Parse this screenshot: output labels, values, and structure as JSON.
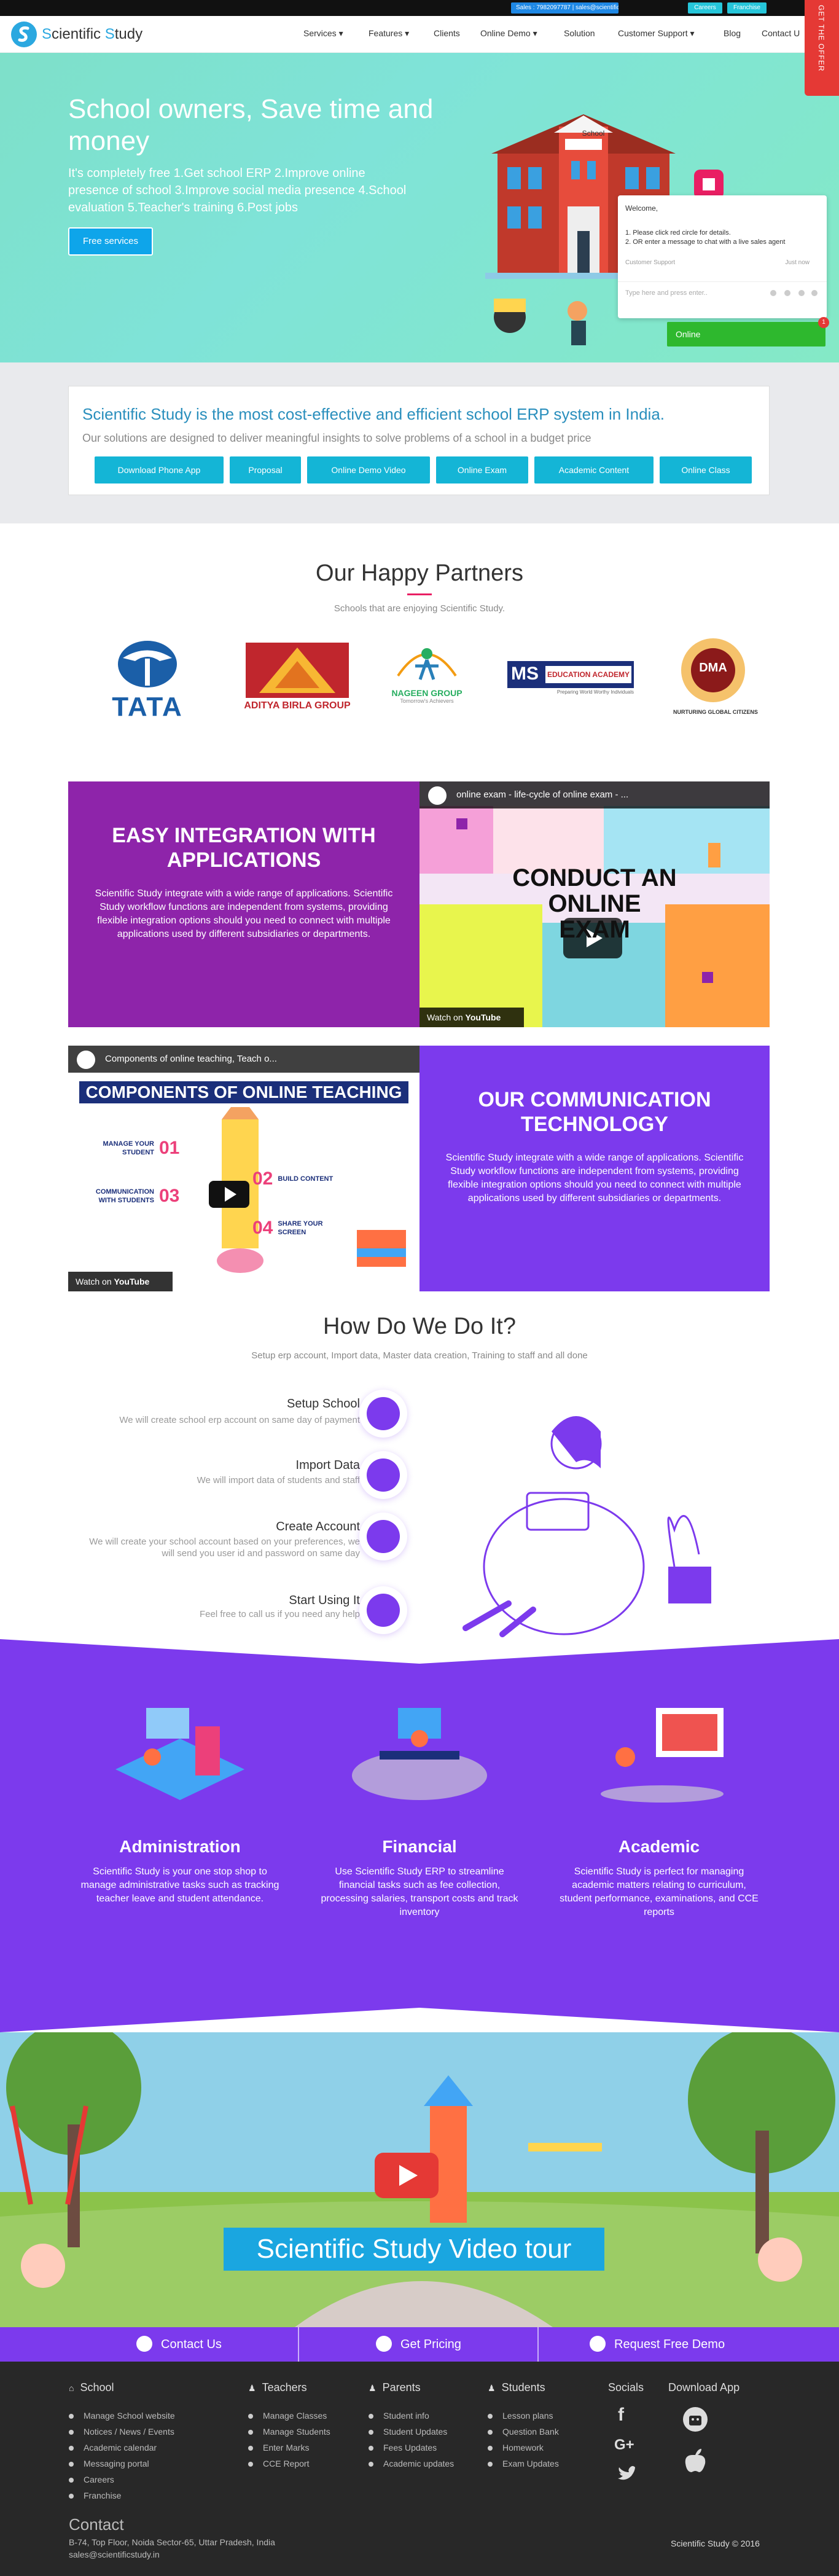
{
  "topbar": {
    "sales": "Sales : 7982097787 | sales@scientificstudy.in",
    "careers": "Careers",
    "franchise": "Franchise"
  },
  "offer_ribbon": "GET THE OFFER",
  "header": {
    "logo_s": "S",
    "logo_first": "cientific ",
    "logo_s2": "S",
    "logo_rest": "tudy",
    "nav": [
      "Services ▾",
      "Features ▾",
      "Clients",
      "Online Demo ▾",
      "Solution",
      "Customer Support ▾",
      "Blog",
      "Contact U"
    ]
  },
  "hero": {
    "title": "School owners, Save time and money",
    "subtitle": "It's completely free 1.Get school ERP 2.Improve online presence of school 3.Improve social media presence 4.School evaluation 5.Teacher's training 6.Post jobs",
    "button": "Free services",
    "building_sign": "School",
    "slides": 5,
    "active_slide": 2
  },
  "chat": {
    "welcome": "Welcome,",
    "message": "1. Please click red circle for details.\n2. OR enter a message to chat with a live sales agent",
    "agent": "Customer Support",
    "time": "Just now",
    "placeholder": "Type here and press enter..",
    "online": "Online",
    "badge": "1"
  },
  "info": {
    "heading": "Scientific Study is the most cost-effective and efficient school ERP system in India.",
    "text": "Our solutions are designed to deliver meaningful insights to solve problems of a school in a budget price",
    "buttons": [
      "Download Phone App",
      "Proposal",
      "Online Demo Video",
      "Online Exam",
      "Academic Content",
      "Online Class"
    ]
  },
  "partners": {
    "title": "Our Happy Partners",
    "subtitle": "Schools that are enjoying Scientific Study.",
    "logos": {
      "tata": "TATA",
      "aditya": "ADITYA BIRLA GROUP",
      "nageen": "NAGEEN GROUP",
      "nageen_tag": "Tomorrow's Achievers",
      "ms": "MS",
      "ms_text": "EDUCATION ACADEMY",
      "ms_tag": "Preparing World Worthy Individuals",
      "dma": "DMA",
      "dma_tag": "NURTURING GLOBAL CITIZENS"
    }
  },
  "integration": {
    "heading": "EASY INTEGRATION WITH APPLICATIONS",
    "text": "Scientific Study integrate with a wide range of applications. Scientific Study workflow functions are independent from systems, providing flexible integration options should you need to connect with multiple applications used by different subsidiaries or departments.",
    "video_title": "online exam - life-cycle of online exam - ...",
    "video_text": "CONDUCT AN ONLINE EXAM",
    "watch": "Watch on",
    "youtube": "YouTube"
  },
  "communication": {
    "heading": "OUR COMMUNICATION TECHNOLOGY",
    "text": "Scientific Study integrate with a wide range of applications. Scientific Study workflow functions are independent from systems, providing flexible integration options should you need to connect with multiple applications used by different subsidiaries or departments.",
    "video_title": "Components of online teaching, Teach o...",
    "banner": "COMPONENTS OF ONLINE TEACHING",
    "items": [
      {
        "num": "01",
        "label": "MANAGE YOUR STUDENT"
      },
      {
        "num": "02",
        "label": "BUILD CONTENT"
      },
      {
        "num": "03",
        "label": "COMMUNICATION WITH STUDENTS"
      },
      {
        "num": "04",
        "label": "SHARE YOUR SCREEN"
      }
    ],
    "watch": "Watch on",
    "youtube": "YouTube"
  },
  "how": {
    "title": "How Do We Do It?",
    "subtitle": "Setup erp account, Import data, Master data creation, Training to staff and all done",
    "steps": [
      {
        "title": "Setup School",
        "desc": "We will create school erp account on same day of payment"
      },
      {
        "title": "Import Data",
        "desc": "We will import data of students and staff"
      },
      {
        "title": "Create Account",
        "desc": "We will create your school account based on your preferences, we will send you user id and password on same day"
      },
      {
        "title": "Start Using It",
        "desc": "Feel free to call us if you need any help"
      }
    ]
  },
  "services": [
    {
      "title": "Administration",
      "text": "Scientific Study is your one stop shop to manage administrative tasks such as tracking teacher leave and student attendance."
    },
    {
      "title": "Financial",
      "text": "Use Scientific Study ERP to streamline financial tasks such as fee collection, processing salaries, transport costs and track inventory"
    },
    {
      "title": "Academic",
      "text": "Scientific Study is perfect for managing academic matters relating to curriculum, student performance, examinations, and CCE reports"
    }
  ],
  "video_tour": {
    "caption": "Scientific Study Video tour"
  },
  "contact_bar": [
    "Contact Us",
    "Get Pricing",
    "Request Free Demo"
  ],
  "footer": {
    "columns": [
      {
        "title": "School",
        "items": [
          "Manage School website",
          "Notices / News / Events",
          "Academic calendar",
          "Messaging portal",
          "Careers",
          "Franchise"
        ]
      },
      {
        "title": "Teachers",
        "items": [
          "Manage Classes",
          "Manage Students",
          "Enter Marks",
          "CCE Report"
        ]
      },
      {
        "title": "Parents",
        "items": [
          "Student info",
          "Student Updates",
          "Fees Updates",
          "Academic updates"
        ]
      },
      {
        "title": "Students",
        "items": [
          "Lesson plans",
          "Question Bank",
          "Homework",
          "Exam Updates"
        ]
      }
    ],
    "socials_title": "Socials",
    "download_title": "Download App",
    "social_glyphs": {
      "facebook": "f",
      "google": "G+"
    },
    "contact_title": "Contact",
    "address": "B-74, Top Floor, Noida Sector-65, Uttar Pradesh, India",
    "email": "sales@scientificstudy.in",
    "copyright": "Scientific Study © 2016"
  },
  "colors": {
    "purple": "#7c3aed",
    "cyan": "#14b5d6",
    "blue_heading": "#2a8fbd",
    "hero_mint": "#7ee0c9",
    "online_green": "#2eb82e",
    "offer_red": "#e53935"
  }
}
